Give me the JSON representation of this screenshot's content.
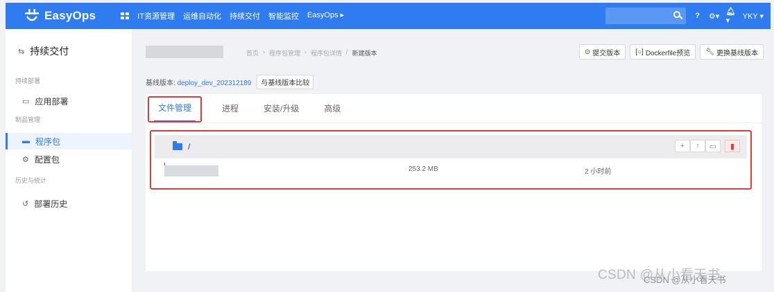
{
  "app": {
    "name": "EasyOps"
  },
  "topnav": {
    "items": [
      "IT资源管理",
      "运维自动化",
      "持续交付",
      "智能监控",
      "EasyOps"
    ],
    "user": "YKY"
  },
  "sidebar": {
    "title": "持续交付",
    "groups": [
      "持续部署",
      "制品管理",
      "历史与统计"
    ],
    "items": [
      "应用部署",
      "程序包",
      "配置包",
      "部署历史"
    ]
  },
  "breadcrumb": {
    "items": [
      "首页",
      "程序包管理",
      "程序包详情",
      "新建版本"
    ]
  },
  "actions": {
    "submit": "提交版本",
    "dockerfile": "Dockerfile预览",
    "replace": "更换基线版本"
  },
  "baseline": {
    "label": "基线版本:",
    "value": "deploy_dev_202312189",
    "compare": "与基线版本比较"
  },
  "tabs": [
    "文件管理",
    "进程",
    "安装/升级",
    "高级"
  ],
  "file_manager": {
    "path": "/",
    "rows": [
      {
        "size": "253.2 MB",
        "time": "2 小时前"
      }
    ]
  },
  "watermark": {
    "primary": "CSDN @从小看天书",
    "secondary": "CSDN @从小看天书"
  },
  "colors": {
    "brand": "#2f7bf0",
    "highlight": "#e03a3a"
  }
}
